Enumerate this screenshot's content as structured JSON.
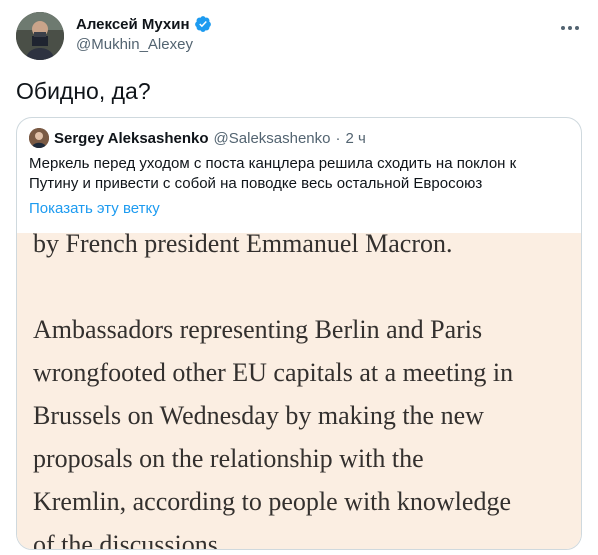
{
  "tweet": {
    "author_name": "Алексей Мухин",
    "author_handle": "@Mukhin_Alexey",
    "text": "Обидно, да?"
  },
  "quoted": {
    "author_name": "Sergey Aleksashenko",
    "author_handle": "@Saleksashenko",
    "separator": "·",
    "time": "2 ч",
    "text": "Меркель перед уходом с поста канцлера решила сходить на поклон к Путину и привести с собой на поводке весь остальной Евросоюз",
    "show_thread": "Показать эту ветку",
    "image_lines": [
      "by French president Emmanuel Macron.",
      "",
      "Ambassadors representing Berlin and Paris",
      "wrongfooted other EU capitals at a meeting in",
      "Brussels on Wednesday by making the new",
      "proposals on the relationship with the",
      "Kremlin, according to people with knowledge",
      "of the discussions."
    ]
  },
  "colors": {
    "accent": "#1d9bf0",
    "article_bg": "#fbeee2",
    "muted": "#536471"
  },
  "icons": {
    "verified": "verified-badge-icon",
    "more": "more-options-icon"
  }
}
